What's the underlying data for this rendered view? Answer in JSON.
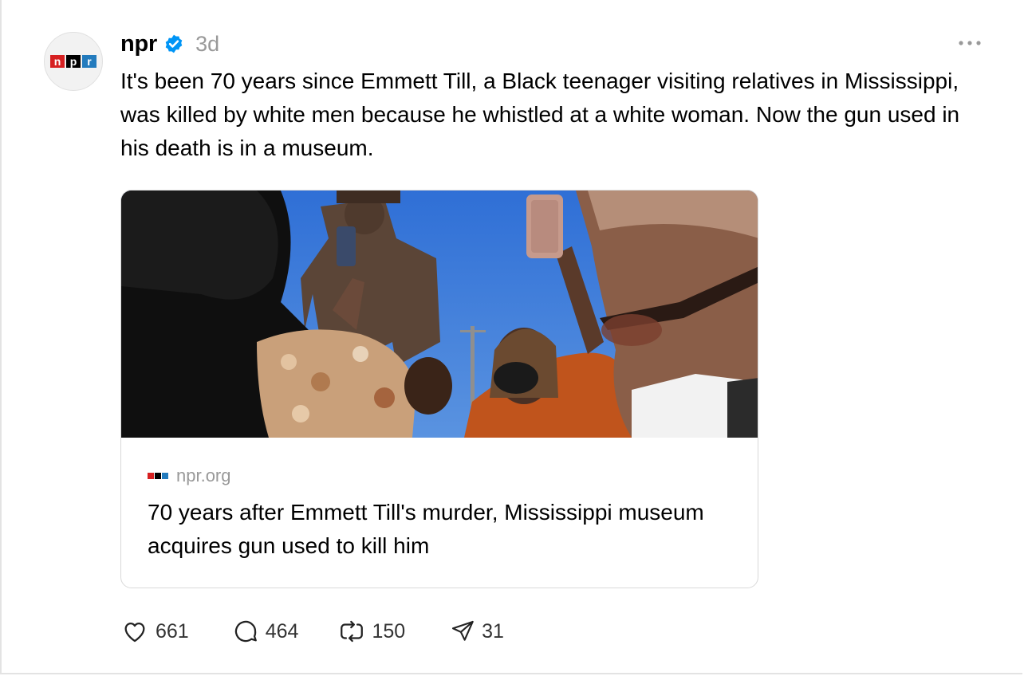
{
  "post": {
    "author": "npr",
    "time": "3d",
    "text": "It's been 70 years since Emmett Till, a Black teenager visiting relatives in Mississippi, was killed by white men because he whistled at a white woman. Now the gun used in his death is in a museum.",
    "avatar_logo": {
      "letters": [
        "n",
        "p",
        "r"
      ],
      "colors": [
        "#d62021",
        "#000000",
        "#237bbd"
      ]
    },
    "verified_icon": "verified-badge-icon",
    "more_icon": "ellipsis-icon"
  },
  "link_card": {
    "domain": "npr.org",
    "title": "70 years after Emmett Till's murder, Mississippi museum acquires gun used to kill him",
    "image_icon": "photo-people-with-statue"
  },
  "actions": {
    "likes": "661",
    "replies": "464",
    "reposts": "150",
    "shares": "31"
  },
  "colors": {
    "verified": "#0095f6",
    "muted": "#999999",
    "border": "#d9d9d9"
  }
}
